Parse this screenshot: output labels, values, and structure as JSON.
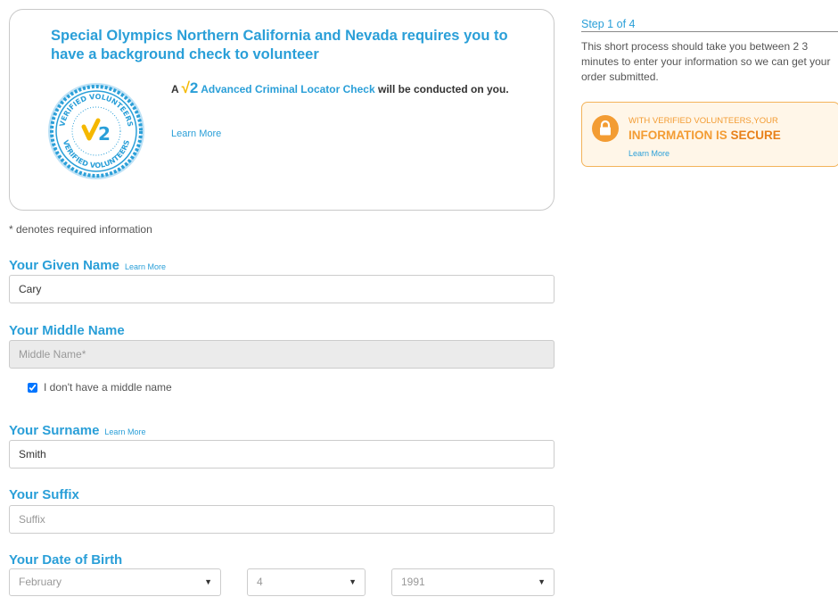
{
  "intro": {
    "title": "Special Olympics Northern California and Nevada requires you to have a background check to volunteer",
    "check_prefix": "A ",
    "check_brand_tick": "√",
    "check_brand_num": "2",
    "check_name": "Advanced Criminal Locator Check",
    "check_suffix": " will be conducted on you.",
    "learn_more": "Learn More",
    "seal_text_top": "VERIFIED VOLUNTEERS",
    "seal_text_bottom": "VERIFIED VOLUNTEERS",
    "seal_logo": "V2"
  },
  "form": {
    "required_note": "* denotes required information",
    "given_name": {
      "label": "Your Given Name",
      "learn_more": "Learn More",
      "value": "Cary"
    },
    "middle_name": {
      "label": "Your Middle Name",
      "placeholder": "Middle Name*",
      "value": "",
      "no_middle_label": "I don't have a middle name",
      "no_middle_checked": true
    },
    "surname": {
      "label": "Your Surname",
      "learn_more": "Learn More",
      "value": "Smith"
    },
    "suffix": {
      "label": "Your Suffix",
      "placeholder": "Suffix",
      "value": ""
    },
    "dob": {
      "label": "Your Date of Birth",
      "month": "February",
      "day": "4",
      "year": "1991"
    }
  },
  "sidebar": {
    "step": "Step 1 of 4",
    "description": "This short process should take you between 2 3 minutes to enter your information so we can get your order submitted.",
    "secure_line1": "WITH VERIFIED VOLUNTEERS,YOUR",
    "secure_line2a": "INFORMATION IS ",
    "secure_line2b": "SECURE",
    "secure_learn": "Learn More"
  },
  "colors": {
    "accent": "#2a9fd8",
    "secure_orange": "#f39c33",
    "brand_yellow": "#f5b800"
  },
  "icons": {
    "lock": "lock-icon",
    "caret": "caret-down-icon",
    "seal": "verified-volunteers-seal-icon"
  }
}
